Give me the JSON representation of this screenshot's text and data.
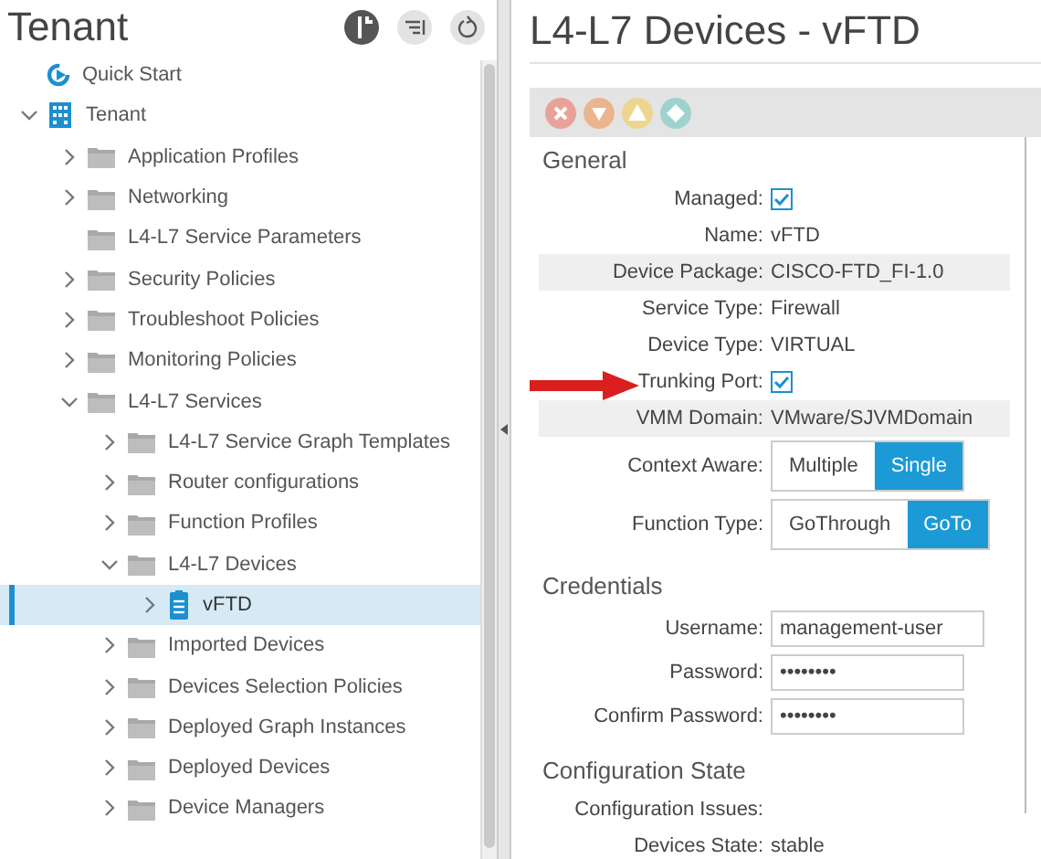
{
  "left_panel": {
    "title": "Tenant",
    "tree": [
      {
        "kind": "quickstart",
        "label": "Quick Start",
        "selected": false
      },
      {
        "kind": "tenant",
        "label": "Tenant",
        "expanded": true,
        "selected": false,
        "children": [
          {
            "kind": "folder",
            "label": "Application Profiles",
            "expanded": false,
            "selected": false
          },
          {
            "kind": "folder",
            "label": "Networking",
            "expanded": false,
            "selected": false
          },
          {
            "kind": "folder",
            "label": "L4-L7 Service Parameters",
            "selected": false
          },
          {
            "kind": "folder",
            "label": "Security Policies",
            "expanded": false,
            "selected": false
          },
          {
            "kind": "folder",
            "label": "Troubleshoot Policies",
            "expanded": false,
            "selected": false
          },
          {
            "kind": "folder",
            "label": "Monitoring Policies",
            "expanded": false,
            "selected": false
          },
          {
            "kind": "folder",
            "label": "L4-L7 Services",
            "expanded": true,
            "selected": false,
            "children": [
              {
                "kind": "folder",
                "label": "L4-L7 Service Graph Templates",
                "expanded": false,
                "selected": false
              },
              {
                "kind": "folder",
                "label": "Router configurations",
                "expanded": false,
                "selected": false
              },
              {
                "kind": "folder",
                "label": "Function Profiles",
                "expanded": false,
                "selected": false
              },
              {
                "kind": "folder",
                "label": "L4-L7 Devices",
                "expanded": true,
                "selected": false,
                "children": [
                  {
                    "kind": "device",
                    "label": "vFTD",
                    "expanded": false,
                    "selected": true
                  }
                ]
              },
              {
                "kind": "folder",
                "label": "Imported Devices",
                "expanded": false,
                "selected": false
              },
              {
                "kind": "folder",
                "label": "Devices Selection Policies",
                "expanded": false,
                "selected": false
              },
              {
                "kind": "folder",
                "label": "Deployed Graph Instances",
                "expanded": false,
                "selected": false
              },
              {
                "kind": "folder",
                "label": "Deployed Devices",
                "expanded": false,
                "selected": false
              },
              {
                "kind": "folder",
                "label": "Device Managers",
                "expanded": false,
                "selected": false
              }
            ]
          }
        ]
      }
    ]
  },
  "right_panel": {
    "title": "L4-L7 Devices - vFTD",
    "fault_icons": [
      {
        "kind": "critical",
        "color": "#e8a29a"
      },
      {
        "kind": "major",
        "color": "#eab48f"
      },
      {
        "kind": "minor",
        "color": "#eed58f"
      },
      {
        "kind": "warning",
        "color": "#9fd1cf"
      }
    ],
    "sections": [
      {
        "title": "General",
        "rows": [
          {
            "kind": "checkbox",
            "label": "Managed:",
            "checked": true,
            "shaded": false,
            "pointed": false
          },
          {
            "kind": "text",
            "label": "Name:",
            "value": "vFTD",
            "shaded": false,
            "pointed": false
          },
          {
            "kind": "text",
            "label": "Device Package:",
            "value": "CISCO-FTD_FI-1.0",
            "shaded": true,
            "pointed": false
          },
          {
            "kind": "text",
            "label": "Service Type:",
            "value": "Firewall",
            "shaded": false,
            "pointed": false
          },
          {
            "kind": "text",
            "label": "Device Type:",
            "value": "VIRTUAL",
            "shaded": false,
            "pointed": false
          },
          {
            "kind": "checkbox",
            "label": "Trunking Port:",
            "checked": true,
            "shaded": false,
            "pointed": true
          },
          {
            "kind": "text",
            "label": "VMM Domain:",
            "value": "VMware/SJVMDomain",
            "shaded": true,
            "pointed": false
          },
          {
            "kind": "toggle",
            "label": "Context Aware:",
            "options": [
              {
                "label": "Multiple",
                "selected": false
              },
              {
                "label": "Single",
                "selected": true
              }
            ],
            "shaded": false,
            "pointed": false
          },
          {
            "kind": "toggle",
            "label": "Function Type:",
            "options": [
              {
                "label": "GoThrough",
                "selected": false
              },
              {
                "label": "GoTo",
                "selected": true
              }
            ],
            "shaded": false,
            "pointed": false
          }
        ]
      },
      {
        "title": "Credentials",
        "rows": [
          {
            "kind": "input",
            "label": "Username:",
            "value": "management-user",
            "shaded": false,
            "pointed": false
          },
          {
            "kind": "input",
            "label": "Password:",
            "value": "••••••••",
            "shaded": false,
            "pointed": false
          },
          {
            "kind": "input",
            "label": "Confirm Password:",
            "value": "••••••••",
            "shaded": false,
            "pointed": false
          }
        ]
      },
      {
        "title": "Configuration State",
        "rows": [
          {
            "kind": "label",
            "label": "Configuration Issues:",
            "shaded": false,
            "pointed": false
          },
          {
            "kind": "text",
            "label": "Devices State:",
            "value": "stable",
            "shaded": false,
            "pointed": false
          }
        ]
      }
    ]
  }
}
